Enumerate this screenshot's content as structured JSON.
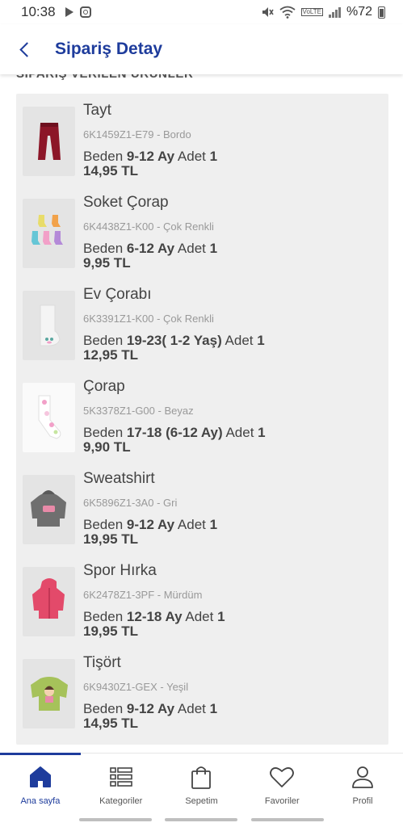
{
  "status_bar": {
    "time": "10:38",
    "battery_text": "%72",
    "icons": [
      "play-icon",
      "instagram-icon",
      "mute-icon",
      "wifi-icon",
      "volte-icon",
      "signal-icon",
      "battery-icon"
    ],
    "volte_text": "VoLTE"
  },
  "header": {
    "title": "Sipariş Detay",
    "back_icon": "chevron-left-icon"
  },
  "section": {
    "title": "SİPARİŞ VERİLEN ÜRÜNLER"
  },
  "products": [
    {
      "name": "Tayt",
      "code": "6K1459Z1-E79 - Bordo",
      "size_label": "Beden",
      "size": "9-12 Ay",
      "qty_label": "Adet",
      "qty": "1",
      "price": "14,95 TL",
      "image": "leggings-image"
    },
    {
      "name": "Soket Çorap",
      "code": "6K4438Z1-K00 - Çok Renkli",
      "size_label": "Beden",
      "size": "6-12 Ay",
      "qty_label": "Adet",
      "qty": "1",
      "price": "9,95 TL",
      "image": "socks-image"
    },
    {
      "name": "Ev Çorabı",
      "code": "6K3391Z1-K00 - Çok Renkli",
      "size_label": "Beden",
      "size": "19-23( 1-2 Yaş)",
      "qty_label": "Adet",
      "qty": "1",
      "price": "12,95 TL",
      "image": "house-socks-image"
    },
    {
      "name": "Çorap",
      "code": "5K3378Z1-G00 - Beyaz",
      "size_label": "Beden",
      "size": "17-18 (6-12 Ay)",
      "qty_label": "Adet",
      "qty": "1",
      "price": "9,90 TL",
      "image": "sock-image"
    },
    {
      "name": "Sweatshirt",
      "code": "6K5896Z1-3A0 - Gri",
      "size_label": "Beden",
      "size": "9-12 Ay",
      "qty_label": "Adet",
      "qty": "1",
      "price": "19,95 TL",
      "image": "sweatshirt-image"
    },
    {
      "name": "Spor Hırka",
      "code": "6K2478Z1-3PF - Mürdüm",
      "size_label": "Beden",
      "size": "12-18 Ay",
      "qty_label": "Adet",
      "qty": "1",
      "price": "19,95 TL",
      "image": "hoodie-image"
    },
    {
      "name": "Tişört",
      "code": "6K9430Z1-GEX - Yeşil",
      "size_label": "Beden",
      "size": "9-12 Ay",
      "qty_label": "Adet",
      "qty": "1",
      "price": "14,95 TL",
      "image": "tshirt-image"
    }
  ],
  "bottom_nav": [
    {
      "label": "Ana sayfa",
      "icon": "home-icon",
      "active": true
    },
    {
      "label": "Kategoriler",
      "icon": "list-icon",
      "active": false
    },
    {
      "label": "Sepetim",
      "icon": "bag-icon",
      "active": false
    },
    {
      "label": "Favoriler",
      "icon": "heart-icon",
      "active": false
    },
    {
      "label": "Profil",
      "icon": "profile-icon",
      "active": false
    }
  ],
  "colors": {
    "brand": "#1e3c9c",
    "card_bg": "#efefef",
    "text": "#444444",
    "muted": "#999999"
  }
}
